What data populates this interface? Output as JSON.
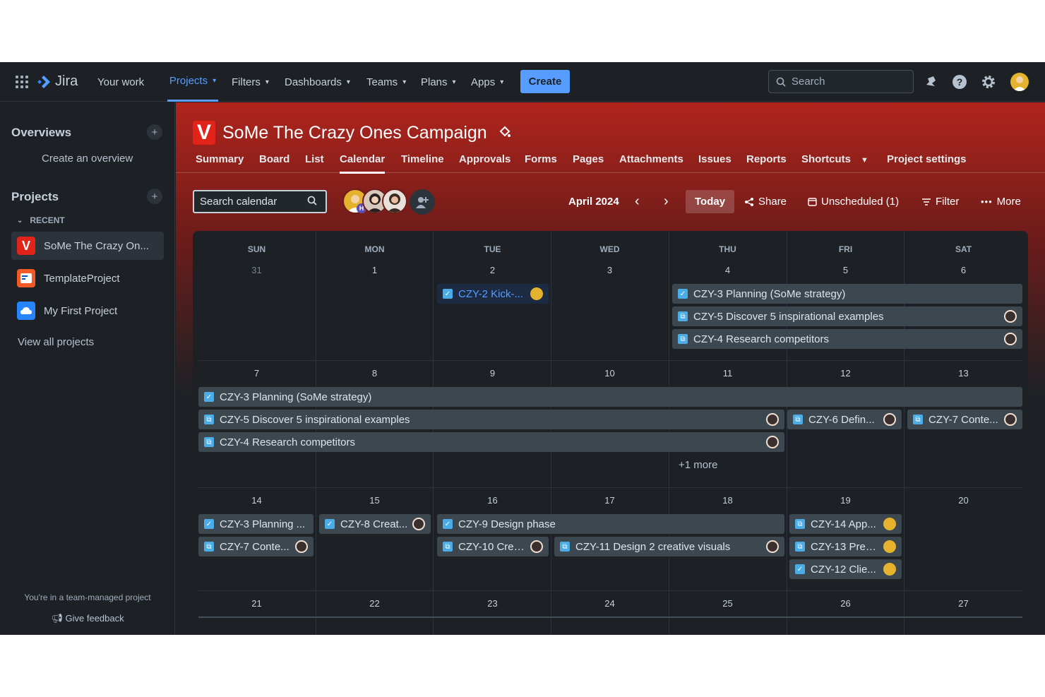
{
  "topnav": {
    "logo": "Jira",
    "items": [
      "Your work",
      "Projects",
      "Filters",
      "Dashboards",
      "Teams",
      "Plans",
      "Apps"
    ],
    "create_label": "Create",
    "search_placeholder": "Search"
  },
  "sidebar": {
    "overviews_title": "Overviews",
    "create_overview": "Create an overview",
    "projects_title": "Projects",
    "recent_label": "RECENT",
    "projects": [
      "SoMe The Crazy On...",
      "TemplateProject",
      "My First Project"
    ],
    "view_all": "View all projects",
    "team_managed": "You're in a team-managed project",
    "feedback": "Give feedback"
  },
  "project": {
    "title": "SoMe The Crazy Ones Campaign",
    "tabs": [
      "Summary",
      "Board",
      "List",
      "Calendar",
      "Timeline",
      "Approvals",
      "Forms",
      "Pages",
      "Attachments",
      "Issues",
      "Reports",
      "Shortcuts",
      "Project settings"
    ],
    "active_tab": "Calendar"
  },
  "toolbar": {
    "search_placeholder": "Search calendar",
    "month": "April 2024",
    "today": "Today",
    "share": "Share",
    "unscheduled": "Unscheduled (1)",
    "filter": "Filter",
    "more": "More",
    "avatar_badge": "H"
  },
  "calendar": {
    "weekdays": [
      "SUN",
      "MON",
      "TUE",
      "WED",
      "THU",
      "FRI",
      "SAT"
    ],
    "weeks": [
      [
        "31",
        "1",
        "2",
        "3",
        "4",
        "5",
        "6"
      ],
      [
        "7",
        "8",
        "9",
        "10",
        "11",
        "12",
        "13"
      ],
      [
        "14",
        "15",
        "16",
        "17",
        "18",
        "19",
        "20"
      ],
      [
        "21",
        "22",
        "23",
        "24",
        "25",
        "26",
        "27"
      ]
    ],
    "events": [
      {
        "label": "CZY-2 Kick-...",
        "type": "task",
        "avatar": "yellow",
        "selected": true
      },
      {
        "label": "CZY-3 Planning (SoMe strategy)",
        "type": "task",
        "avatar": ""
      },
      {
        "label": "CZY-5 Discover 5 inspirational examples",
        "type": "subtask",
        "avatar": "dark"
      },
      {
        "label": "CZY-4 Research competitors",
        "type": "subtask",
        "avatar": "dark"
      },
      {
        "label": "CZY-3 Planning (SoMe strategy)",
        "type": "task",
        "avatar": ""
      },
      {
        "label": "CZY-5 Discover 5 inspirational examples",
        "type": "subtask",
        "avatar": "dark"
      },
      {
        "label": "CZY-6 Defin...",
        "type": "subtask",
        "avatar": "dark"
      },
      {
        "label": "CZY-7 Conte...",
        "type": "subtask",
        "avatar": "dark"
      },
      {
        "label": "CZY-4 Research competitors",
        "type": "subtask",
        "avatar": "dark"
      },
      {
        "label": "CZY-3 Planning ...",
        "type": "task",
        "avatar": ""
      },
      {
        "label": "CZY-8 Creat...",
        "type": "task",
        "avatar": "dark"
      },
      {
        "label": "CZY-9 Design phase",
        "type": "task",
        "avatar": ""
      },
      {
        "label": "CZY-14 App...",
        "type": "subtask",
        "avatar": "yellow"
      },
      {
        "label": "CZY-7 Conte...",
        "type": "subtask",
        "avatar": "dark"
      },
      {
        "label": "CZY-10 Crea...",
        "type": "subtask",
        "avatar": "dark"
      },
      {
        "label": "CZY-11 Design 2 creative visuals",
        "type": "subtask",
        "avatar": "dark"
      },
      {
        "label": "CZY-13 Pres...",
        "type": "subtask",
        "avatar": "yellow"
      },
      {
        "label": "CZY-12 Clie...",
        "type": "task",
        "avatar": "yellow"
      }
    ],
    "more_link": "+1 more"
  },
  "colors": {
    "accent": "#579dff",
    "brand": "#e2231a",
    "background": "#1d2125"
  }
}
